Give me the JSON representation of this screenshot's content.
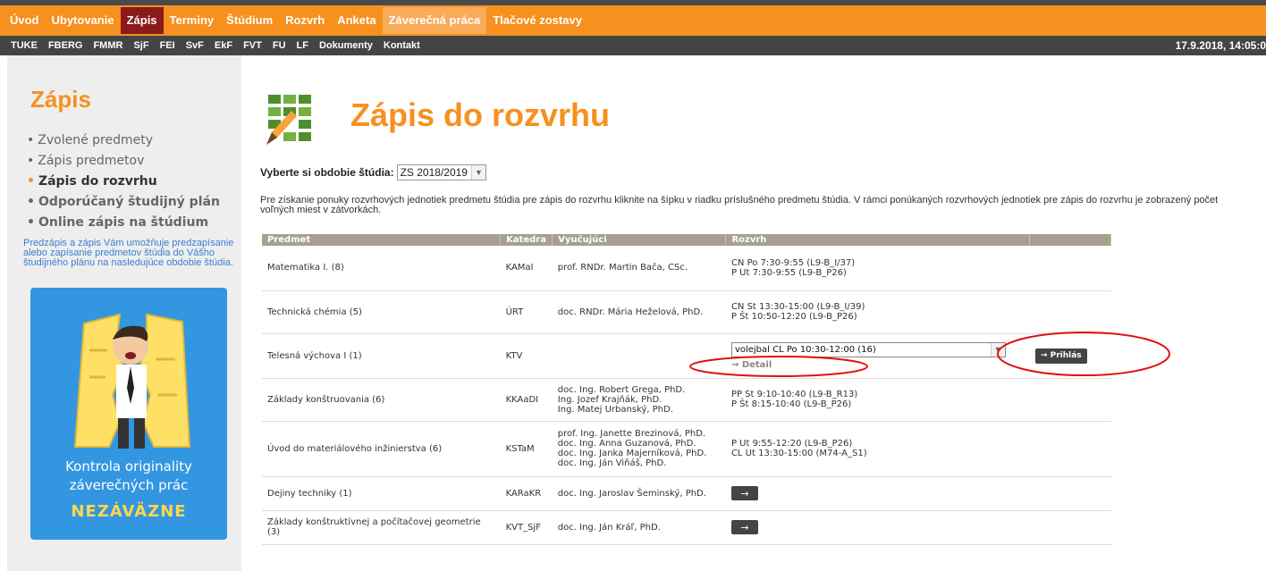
{
  "main_nav": [
    {
      "label": "Úvod"
    },
    {
      "label": "Ubytovanie"
    },
    {
      "label": "Zápis"
    },
    {
      "label": "Terminy"
    },
    {
      "label": "Štúdium"
    },
    {
      "label": "Rozvrh"
    },
    {
      "label": "Anketa"
    },
    {
      "label": "Záverečná práca"
    },
    {
      "label": "Tlačové zostavy"
    }
  ],
  "sub_nav": [
    "TUKE",
    "FBERG",
    "FMMR",
    "SjF",
    "FEI",
    "SvF",
    "EkF",
    "FVT",
    "FU",
    "LF",
    "Dokumenty",
    "Kontakt"
  ],
  "datetime": "17.9.2018,  14:05:0",
  "sidebar": {
    "title": "Zápis",
    "items": [
      {
        "label": "Zvolené predmety"
      },
      {
        "label": "Zápis predmetov"
      },
      {
        "label": "Zápis do rozvrhu"
      },
      {
        "label": "Odporúčaný študijný plán"
      },
      {
        "label": "Online zápis na štúdium"
      }
    ],
    "note": "Predzápis a zápis Vám umožňuje predzapísanie alebo zapísanie predmetov štúdia do Vášho študijného plánu na nasledujúce obdobie štúdia.",
    "banner_text_1": "Kontrola originality",
    "banner_text_2": "záverečných prác",
    "banner_cta": "NEZÁVÄZNE"
  },
  "page_title": "Zápis do rozvrhu",
  "period": {
    "label": "Vyberte si obdobie štúdia:",
    "value": "ZS 2018/2019"
  },
  "intro_text": "Pre získanie ponuky rozvrhových jednotiek predmetu štúdia pre zápis do rozvrhu kliknite na šípku v riadku príslušného predmetu štúdia. V rámci ponúkaných rozvrhových jednotiek pre zápis do rozvrhu je zobrazený počet voľných miest v zátvorkách.",
  "table": {
    "headers": [
      "Predmet",
      "Katedra",
      "Vyučujúci",
      "Rozvrh",
      ""
    ],
    "rows": [
      {
        "subject": "Matematika I. (8)",
        "dept": "KAMaI",
        "teacher_1": "prof. RNDr. Martin Bača, CSc.",
        "sched_1": "CN Po 7:30-9:55 (L9-B_I/37)",
        "sched_2": "P Ut 7:30-9:55 (L9-B_P26)"
      },
      {
        "subject": "Technická chémia (5)",
        "dept": "ÚRT",
        "teacher_1": "doc. RNDr. Mária Heželová, PhD.",
        "sched_1": "CN St 13:30-15:00 (L9-B_I/39)",
        "sched_2": "P Št 10:50-12:20 (L9-B_P26)"
      },
      {
        "subject": "Telesná výchova I (1)",
        "dept": "KTV",
        "combo_value": "volejbal CL Po 10:30-12:00 (16)",
        "detail": "Detail",
        "login": "Prihlás"
      },
      {
        "subject": "Základy konštruovania (6)",
        "dept": "KKAaDI",
        "teacher_1": "doc. Ing. Robert Grega, PhD.",
        "teacher_2": "Ing. Jozef Krajňák, PhD.",
        "teacher_3": "Ing. Matej Urbanský, PhD.",
        "sched_1": "PP St 9:10-10:40 (L9-B_R13)",
        "sched_2": "P Št 8:15-10:40 (L9-B_P26)"
      },
      {
        "subject": "Úvod do materiálového inžinierstva (6)",
        "dept": "KSTaM",
        "teacher_1": "prof. Ing. Janette Brezinová, PhD.",
        "teacher_2": "doc. Ing. Anna Guzanová, PhD.",
        "teacher_3": "doc. Ing. Janka Majerníková, PhD.",
        "teacher_4": "doc. Ing. Ján Viňáš, PhD.",
        "sched_1": "P Ut 9:55-12:20 (L9-B_P26)",
        "sched_2": "CL Ut 13:30-15:00 (M74-A_S1)"
      },
      {
        "subject": "Dejiny techniky (1)",
        "dept": "KARaKR",
        "teacher_1": "doc. Ing. Jaroslav Šeminský, PhD."
      },
      {
        "subject": "Základy konštruktívnej a počítačovej geometrie (3)",
        "dept": "KVT_SjF",
        "teacher_1": "doc. Ing. Ján Kráľ, PhD."
      }
    ]
  },
  "colors": {
    "accent": "#f7901e",
    "active_nav": "#8b1a1a",
    "annotation": "#e01010",
    "table_header": "#a6a08f",
    "banner": "#3396e0"
  },
  "icons": {
    "page": "checklist-pencil-icon",
    "arrow": "right-arrow-icon",
    "dropdown": "chevron-down-icon"
  }
}
